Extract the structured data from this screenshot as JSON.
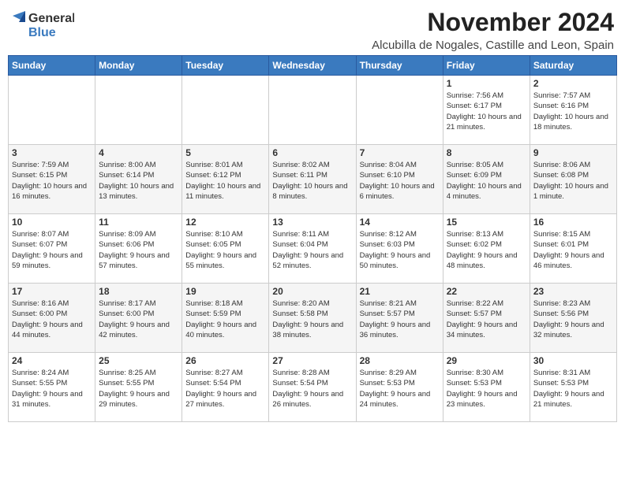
{
  "logo": {
    "general": "General",
    "blue": "Blue"
  },
  "title": "November 2024",
  "location": "Alcubilla de Nogales, Castille and Leon, Spain",
  "days_header": [
    "Sunday",
    "Monday",
    "Tuesday",
    "Wednesday",
    "Thursday",
    "Friday",
    "Saturday"
  ],
  "weeks": [
    [
      {
        "day": "",
        "info": ""
      },
      {
        "day": "",
        "info": ""
      },
      {
        "day": "",
        "info": ""
      },
      {
        "day": "",
        "info": ""
      },
      {
        "day": "",
        "info": ""
      },
      {
        "day": "1",
        "info": "Sunrise: 7:56 AM\nSunset: 6:17 PM\nDaylight: 10 hours and 21 minutes."
      },
      {
        "day": "2",
        "info": "Sunrise: 7:57 AM\nSunset: 6:16 PM\nDaylight: 10 hours and 18 minutes."
      }
    ],
    [
      {
        "day": "3",
        "info": "Sunrise: 7:59 AM\nSunset: 6:15 PM\nDaylight: 10 hours and 16 minutes."
      },
      {
        "day": "4",
        "info": "Sunrise: 8:00 AM\nSunset: 6:14 PM\nDaylight: 10 hours and 13 minutes."
      },
      {
        "day": "5",
        "info": "Sunrise: 8:01 AM\nSunset: 6:12 PM\nDaylight: 10 hours and 11 minutes."
      },
      {
        "day": "6",
        "info": "Sunrise: 8:02 AM\nSunset: 6:11 PM\nDaylight: 10 hours and 8 minutes."
      },
      {
        "day": "7",
        "info": "Sunrise: 8:04 AM\nSunset: 6:10 PM\nDaylight: 10 hours and 6 minutes."
      },
      {
        "day": "8",
        "info": "Sunrise: 8:05 AM\nSunset: 6:09 PM\nDaylight: 10 hours and 4 minutes."
      },
      {
        "day": "9",
        "info": "Sunrise: 8:06 AM\nSunset: 6:08 PM\nDaylight: 10 hours and 1 minute."
      }
    ],
    [
      {
        "day": "10",
        "info": "Sunrise: 8:07 AM\nSunset: 6:07 PM\nDaylight: 9 hours and 59 minutes."
      },
      {
        "day": "11",
        "info": "Sunrise: 8:09 AM\nSunset: 6:06 PM\nDaylight: 9 hours and 57 minutes."
      },
      {
        "day": "12",
        "info": "Sunrise: 8:10 AM\nSunset: 6:05 PM\nDaylight: 9 hours and 55 minutes."
      },
      {
        "day": "13",
        "info": "Sunrise: 8:11 AM\nSunset: 6:04 PM\nDaylight: 9 hours and 52 minutes."
      },
      {
        "day": "14",
        "info": "Sunrise: 8:12 AM\nSunset: 6:03 PM\nDaylight: 9 hours and 50 minutes."
      },
      {
        "day": "15",
        "info": "Sunrise: 8:13 AM\nSunset: 6:02 PM\nDaylight: 9 hours and 48 minutes."
      },
      {
        "day": "16",
        "info": "Sunrise: 8:15 AM\nSunset: 6:01 PM\nDaylight: 9 hours and 46 minutes."
      }
    ],
    [
      {
        "day": "17",
        "info": "Sunrise: 8:16 AM\nSunset: 6:00 PM\nDaylight: 9 hours and 44 minutes."
      },
      {
        "day": "18",
        "info": "Sunrise: 8:17 AM\nSunset: 6:00 PM\nDaylight: 9 hours and 42 minutes."
      },
      {
        "day": "19",
        "info": "Sunrise: 8:18 AM\nSunset: 5:59 PM\nDaylight: 9 hours and 40 minutes."
      },
      {
        "day": "20",
        "info": "Sunrise: 8:20 AM\nSunset: 5:58 PM\nDaylight: 9 hours and 38 minutes."
      },
      {
        "day": "21",
        "info": "Sunrise: 8:21 AM\nSunset: 5:57 PM\nDaylight: 9 hours and 36 minutes."
      },
      {
        "day": "22",
        "info": "Sunrise: 8:22 AM\nSunset: 5:57 PM\nDaylight: 9 hours and 34 minutes."
      },
      {
        "day": "23",
        "info": "Sunrise: 8:23 AM\nSunset: 5:56 PM\nDaylight: 9 hours and 32 minutes."
      }
    ],
    [
      {
        "day": "24",
        "info": "Sunrise: 8:24 AM\nSunset: 5:55 PM\nDaylight: 9 hours and 31 minutes."
      },
      {
        "day": "25",
        "info": "Sunrise: 8:25 AM\nSunset: 5:55 PM\nDaylight: 9 hours and 29 minutes."
      },
      {
        "day": "26",
        "info": "Sunrise: 8:27 AM\nSunset: 5:54 PM\nDaylight: 9 hours and 27 minutes."
      },
      {
        "day": "27",
        "info": "Sunrise: 8:28 AM\nSunset: 5:54 PM\nDaylight: 9 hours and 26 minutes."
      },
      {
        "day": "28",
        "info": "Sunrise: 8:29 AM\nSunset: 5:53 PM\nDaylight: 9 hours and 24 minutes."
      },
      {
        "day": "29",
        "info": "Sunrise: 8:30 AM\nSunset: 5:53 PM\nDaylight: 9 hours and 23 minutes."
      },
      {
        "day": "30",
        "info": "Sunrise: 8:31 AM\nSunset: 5:53 PM\nDaylight: 9 hours and 21 minutes."
      }
    ]
  ]
}
